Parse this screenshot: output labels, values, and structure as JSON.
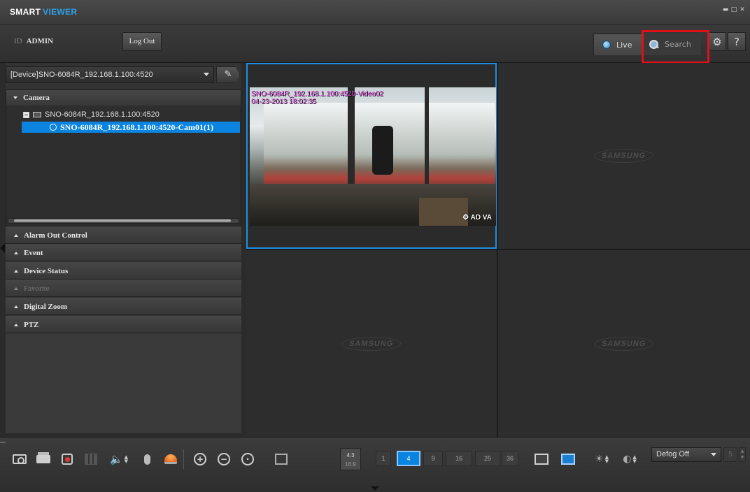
{
  "app": {
    "title_a": "SMART",
    "title_b": "VIEWER"
  },
  "header": {
    "id_label": "ID",
    "user": "ADMIN",
    "logout_label": "Log Out",
    "tab_live": "Live",
    "tab_search": "Search",
    "settings_icon": "gear-icon",
    "help_label": "?"
  },
  "device_select": {
    "value": "[Device]SNO-6084R_192.168.1.100:4520"
  },
  "tree": {
    "header": "Camera",
    "device": "SNO-6084R_192.168.1.100:4520",
    "camera": "SNO-6084R_192.168.1.100:4520-Cam01(1)"
  },
  "sections": [
    {
      "label": "Alarm Out Control",
      "enabled": true
    },
    {
      "label": "Event",
      "enabled": true
    },
    {
      "label": "Device Status",
      "enabled": true
    },
    {
      "label": "Favorite",
      "enabled": false
    },
    {
      "label": "Digital Zoom",
      "enabled": true
    },
    {
      "label": "PTZ",
      "enabled": true
    }
  ],
  "video": {
    "osd_name": "SNO-6084R_192.168.1.100:4520-Video02",
    "osd_time": "04-23-2013 18:02:35",
    "osd_status": "AD VA",
    "empty_logo": "SAMSUNG"
  },
  "toolbar": {
    "ratio_a": "4:3",
    "ratio_b": "16:9",
    "layouts": [
      "1",
      "4",
      "9",
      "16",
      "25",
      "36"
    ],
    "active_layout": "4",
    "defog_value": "Defog Off",
    "defog_level": "5"
  },
  "colors": {
    "accent": "#0a84e0",
    "highlight": "#e0101a",
    "brand_blue": "#2ea0e8"
  }
}
